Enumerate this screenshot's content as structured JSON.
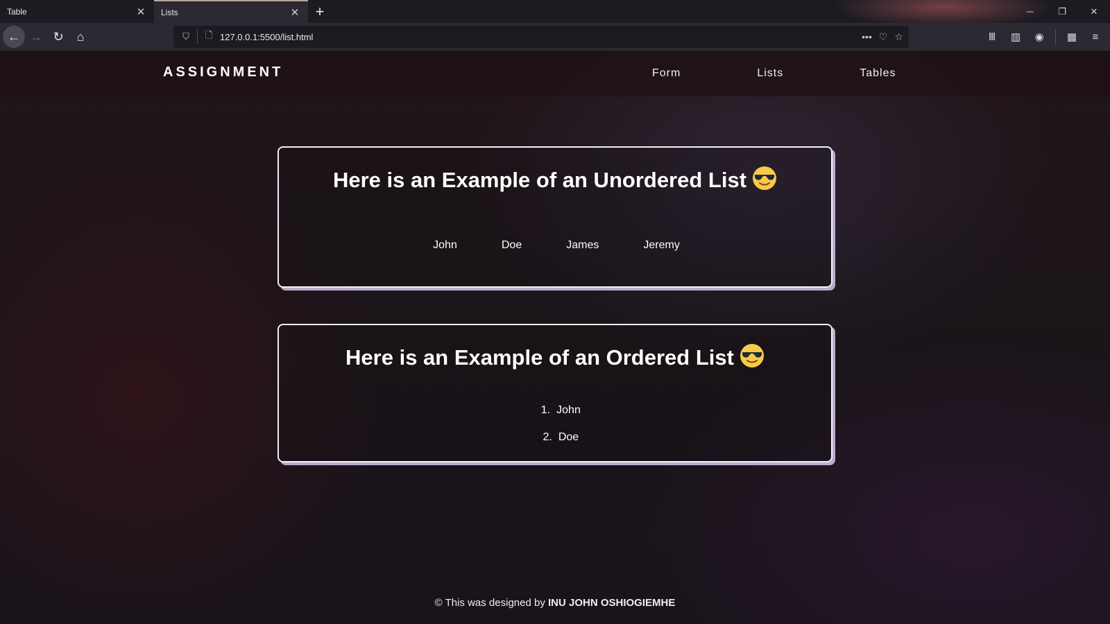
{
  "browser": {
    "tabs": [
      {
        "title": "Table",
        "close": "✕"
      },
      {
        "title": "Lists",
        "close": "✕"
      }
    ],
    "new_tab": "+",
    "url": "127.0.0.1:5500/list.html",
    "window_controls": {
      "minimize": "─",
      "restore": "❐",
      "close": "✕"
    },
    "icons": {
      "back": "←",
      "forward": "→",
      "reload": "↻",
      "home": "⌂",
      "shield": "⛉",
      "page": "🗋",
      "more": "•••",
      "pocket": "♡",
      "star": "☆",
      "library": "Ⅲ",
      "sidebar": "▥",
      "account": "◉",
      "extensions": "▦",
      "menu": "≡"
    }
  },
  "site": {
    "brand": "ASSIGNMENT",
    "nav": [
      "Form",
      "Lists",
      "Tables"
    ]
  },
  "unordered": {
    "title": "Here is an Example of an Unordered List",
    "items": [
      "John",
      "Doe",
      "James",
      "Jeremy"
    ]
  },
  "ordered": {
    "title": "Here is an Example of an Ordered List",
    "items": [
      {
        "num": "1.",
        "text": "John"
      },
      {
        "num": "2.",
        "text": "Doe"
      }
    ]
  },
  "footer": {
    "prefix": "© This was designed by",
    "author": "INU JOHN OSHIOGIEMHE"
  },
  "colors": {
    "card_border": "#f4f2f8",
    "card_shadow": "#d2c8eb",
    "emoji_face": "#f7c948",
    "background": "#1c1620"
  }
}
